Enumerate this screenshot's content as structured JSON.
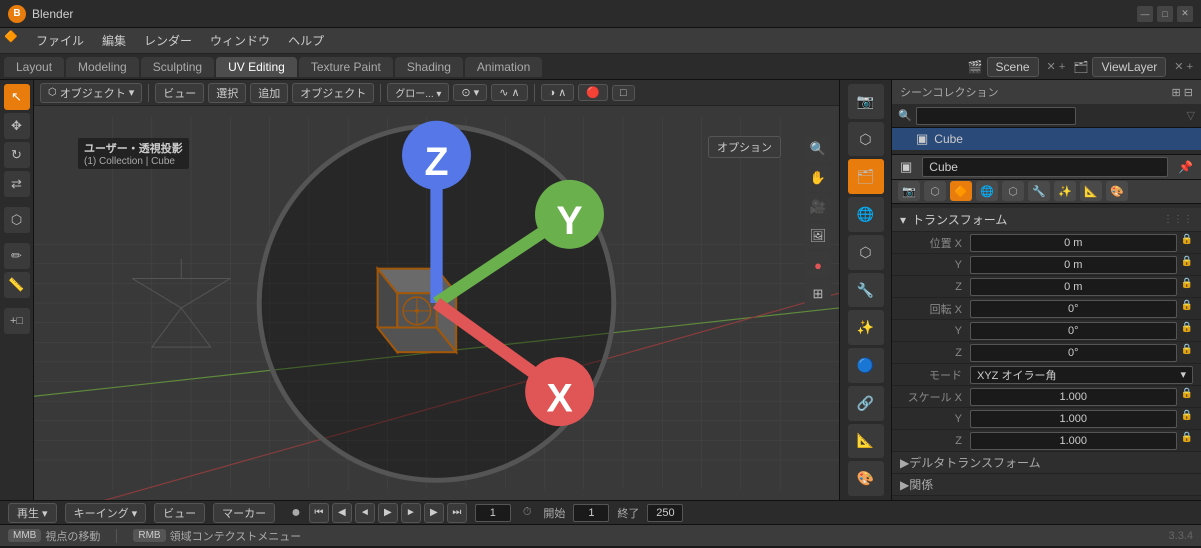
{
  "titlebar": {
    "title": "Blender",
    "minimize": "—",
    "maximize": "□",
    "close": "✕"
  },
  "menubar": {
    "items": [
      "ファイル",
      "編集",
      "レンダー",
      "ウィンドウ",
      "ヘルプ"
    ]
  },
  "workspace_tabs": {
    "items": [
      "Layout",
      "Modeling",
      "Sculpting",
      "UV Editing",
      "Texture Paint",
      "Shading",
      "Animation"
    ],
    "active": "Layout"
  },
  "scene_selector": {
    "label": "Scene",
    "view_layer": "ViewLayer"
  },
  "viewport_header": {
    "mode_label": "オブジェクト",
    "view_label": "ビュー",
    "select_label": "選択",
    "add_label": "追加",
    "object_label": "オブジェクト",
    "global_label": "グロー...",
    "options_label": "オプション"
  },
  "viewport_info": {
    "mode": "ユーザー・透視投影",
    "collection": "(1) Collection | Cube"
  },
  "nav_gizmo": {
    "x_color": "#e05555",
    "y_color": "#6ab04c",
    "z_color": "#5577e8"
  },
  "outliner": {
    "title": "シーンコレクション",
    "search_placeholder": "",
    "items": [
      {
        "icon": "▣",
        "label": "Cube",
        "active": true
      }
    ]
  },
  "object_header": {
    "icon": "▣",
    "cube_label": "Cube",
    "name_value": "Cube",
    "pin_label": "📌"
  },
  "properties": {
    "transform_title": "トランスフォーム",
    "location_label": "位置",
    "x_val": "0 m",
    "y_val": "0 m",
    "z_val": "0 m",
    "rotation_label": "回転",
    "rx_val": "0°",
    "ry_val": "0°",
    "rz_val": "0°",
    "mode_label": "モード",
    "mode_value": "XYZ オイラー角",
    "scale_label": "スケール",
    "sx_val": "1.000",
    "sy_val": "1.000",
    "sz_val": "1.000",
    "delta_label": "デルタトランスフォーム",
    "close_label": "関係"
  },
  "bottom_bar": {
    "play_label": "再生",
    "keying_label": "キーイング",
    "view_label": "ビュー",
    "marker_label": "マーカー",
    "frame_current": "1",
    "frame_start_label": "開始",
    "frame_start": "1",
    "frame_end_label": "終了",
    "frame_end": "250"
  },
  "statusbar": {
    "mouse_hint": "視点の移動",
    "context_hint": "領域コンテクストメニュー",
    "version": "3.3.4"
  },
  "left_tools": [
    "↖",
    "✥",
    "↻",
    "⇄",
    "⬡",
    "⬡",
    "✏",
    "⬡"
  ],
  "right_view_tools": [
    "🔍",
    "↔",
    "🎥",
    "🖼",
    "🔴",
    "📋"
  ],
  "prop_tabs": [
    "📷",
    "🔧",
    "⬡",
    "🔷",
    "🔵",
    "📐",
    "✨",
    "🎨",
    "🔗"
  ]
}
